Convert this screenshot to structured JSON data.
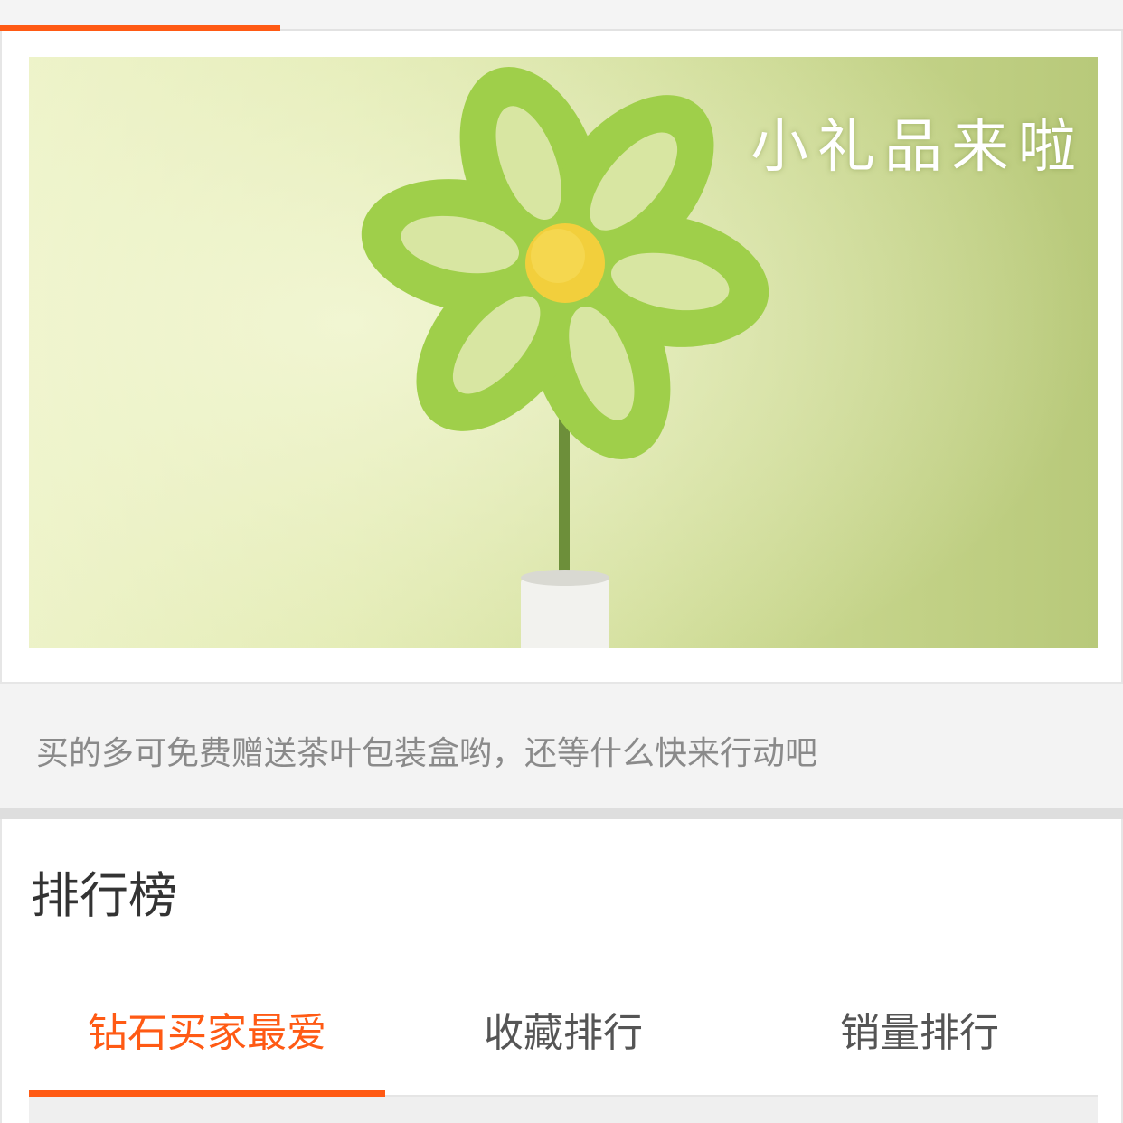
{
  "banner": {
    "caption": "小礼品来啦"
  },
  "promo": {
    "text": "买的多可免费赠送茶叶包装盒哟，还等什么快来行动吧"
  },
  "ranking": {
    "title": "排行榜",
    "tabs": [
      {
        "label": "钻石买家最爱",
        "active": true
      },
      {
        "label": "收藏排行",
        "active": false
      },
      {
        "label": "销量排行",
        "active": false
      }
    ]
  },
  "colors": {
    "accent": "#ff5a14",
    "background": "#f2f2f2",
    "card": "#ffffff",
    "muted_text": "#8a8a8a",
    "title_text": "#333333"
  }
}
